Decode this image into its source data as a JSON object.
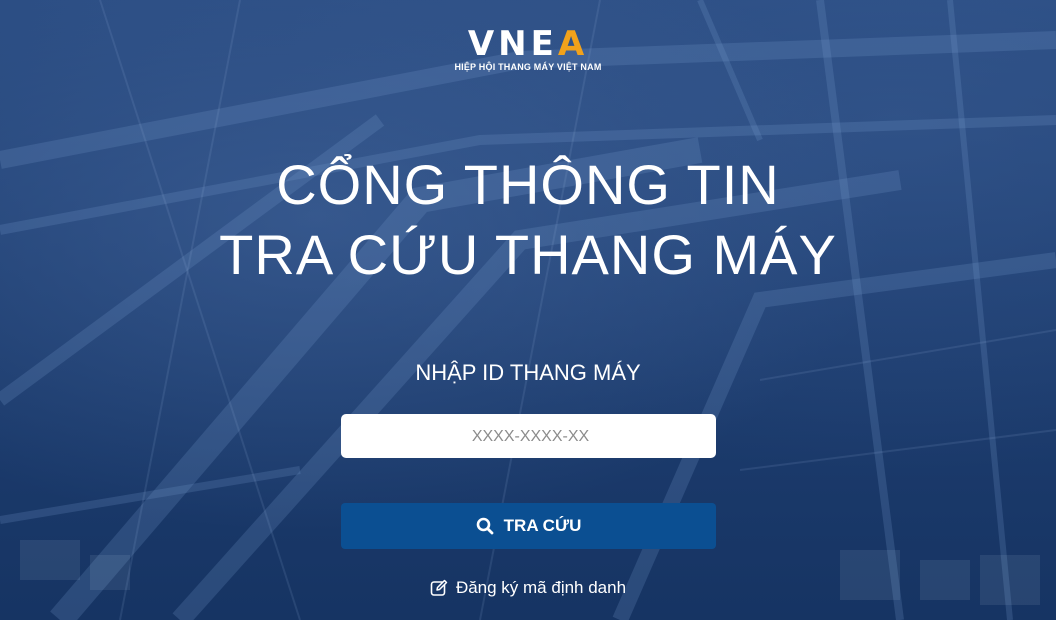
{
  "logo": {
    "mark_main": "VNE",
    "mark_accent": "A",
    "subtitle": "HIỆP HỘI THANG MÁY VIỆT NAM"
  },
  "hero": {
    "title_line1": "CỔNG THÔNG TIN",
    "title_line2": "TRA CỨU THANG MÁY"
  },
  "search": {
    "label": "NHẬP ID THANG MÁY",
    "placeholder": "XXXX-XXXX-XX",
    "value": "",
    "button_label": "TRA CỨU",
    "button_icon": "search-icon"
  },
  "register": {
    "label": "Đăng ký mã định danh",
    "icon": "edit-icon"
  },
  "colors": {
    "background": "#1d3c6e",
    "button": "#0b4f92",
    "logo_accent": "#f2a21b",
    "text": "#ffffff"
  }
}
